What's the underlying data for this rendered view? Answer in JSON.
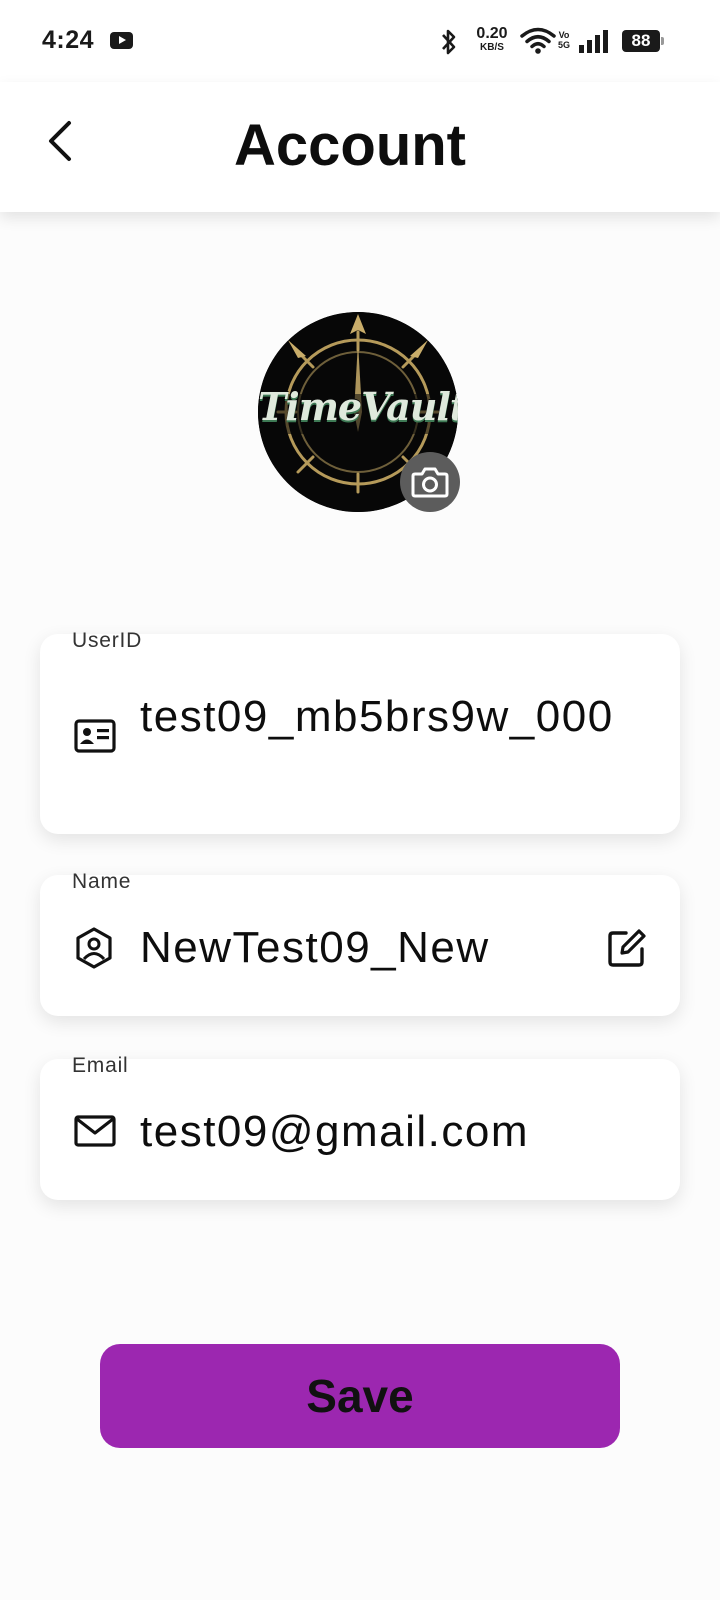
{
  "status_bar": {
    "time": "4:24",
    "net_speed_value": "0.20",
    "net_speed_unit": "KB/S",
    "volte_top": "Vo",
    "volte_bottom": "5G",
    "battery": "88"
  },
  "header": {
    "title": "Account",
    "back_icon": "chevron-left-icon"
  },
  "avatar": {
    "logo_text": "TimeVault",
    "camera_icon": "camera-icon"
  },
  "fields": {
    "userid": {
      "label": "UserID",
      "value": "test09_mb5brs9w_000",
      "icon": "id-card-icon"
    },
    "name": {
      "label": "Name",
      "value": "NewTest09_New",
      "icon": "user-shield-icon",
      "action_icon": "edit-icon"
    },
    "email": {
      "label": "Email",
      "value": "test09@gmail.com",
      "icon": "mail-icon"
    }
  },
  "actions": {
    "save_label": "Save"
  },
  "colors": {
    "accent": "#9c27b0",
    "background": "#fcfcfc",
    "card": "#ffffff"
  }
}
